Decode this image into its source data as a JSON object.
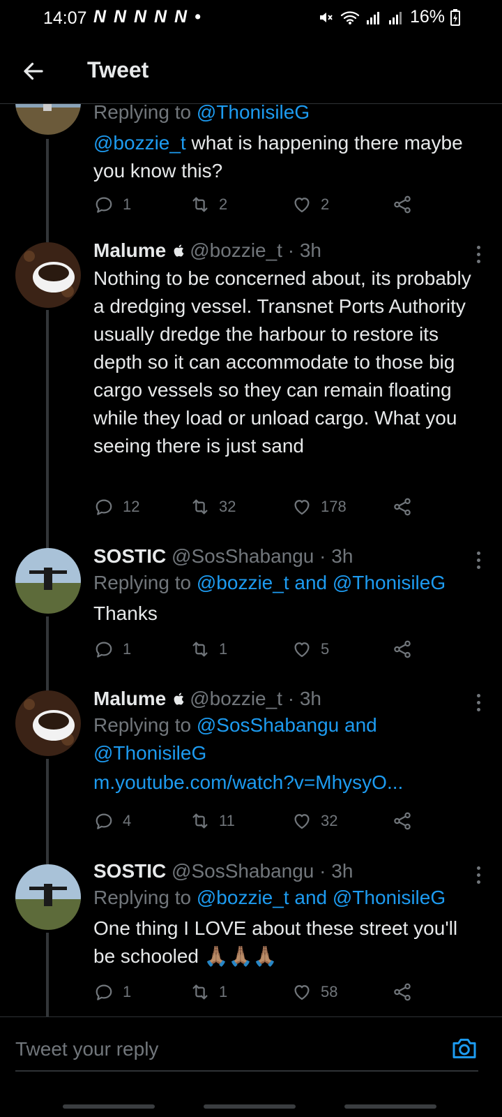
{
  "status_bar": {
    "time": "14:07",
    "notifications": "N N N N N •",
    "battery": "16%"
  },
  "header": {
    "title": "Tweet"
  },
  "tweets": [
    {
      "reply_to_prefix": "Replying to ",
      "reply_to_users": "@ThonisileG",
      "mention": "@bozzie_t",
      "text": " what is happening there maybe you know this?",
      "replies": "1",
      "retweets": "2",
      "likes": "2"
    },
    {
      "name": "Malume",
      "handle": "@bozzie_t",
      "time": "· 3h",
      "text": "Nothing to be concerned about, its probably a dredging vessel. Transnet Ports Authority usually dredge the harbour to restore its depth so it can accommodate to those big cargo vessels so they can remain floating while they load or unload cargo. What you seeing there is just sand",
      "replies": "12",
      "retweets": "32",
      "likes": "178"
    },
    {
      "name": "SOSTIC",
      "handle": "@SosShabangu",
      "time": "· 3h",
      "reply_to_prefix": "Replying to ",
      "reply_to_users": "@bozzie_t and @ThonisileG",
      "text": "Thanks",
      "replies": "1",
      "retweets": "1",
      "likes": "5"
    },
    {
      "name": "Malume",
      "handle": "@bozzie_t",
      "time": "· 3h",
      "reply_to_prefix": "Replying to ",
      "reply_to_users": "@SosShabangu and @ThonisileG",
      "link": "m.youtube.com/watch?v=MhysyO...",
      "replies": "4",
      "retweets": "11",
      "likes": "32"
    },
    {
      "name": "SOSTIC",
      "handle": "@SosShabangu",
      "time": "· 3h",
      "reply_to_prefix": "Replying to ",
      "reply_to_users": "@bozzie_t and @ThonisileG",
      "text": "One thing I LOVE about these street you'll be schooled 🙏🏽🙏🏽🙏🏽",
      "replies": "1",
      "retweets": "1",
      "likes": "58"
    }
  ],
  "reply_bar": {
    "placeholder": "Tweet your reply"
  },
  "icons": [
    "back-arrow-icon",
    "reply-icon",
    "retweet-icon",
    "like-icon",
    "share-icon",
    "more-icon",
    "camera-icon",
    "apple-icon"
  ],
  "colors": {
    "background": "#000000",
    "link": "#1d9bf0",
    "muted": "#71767b",
    "text": "#e7e9ea"
  }
}
